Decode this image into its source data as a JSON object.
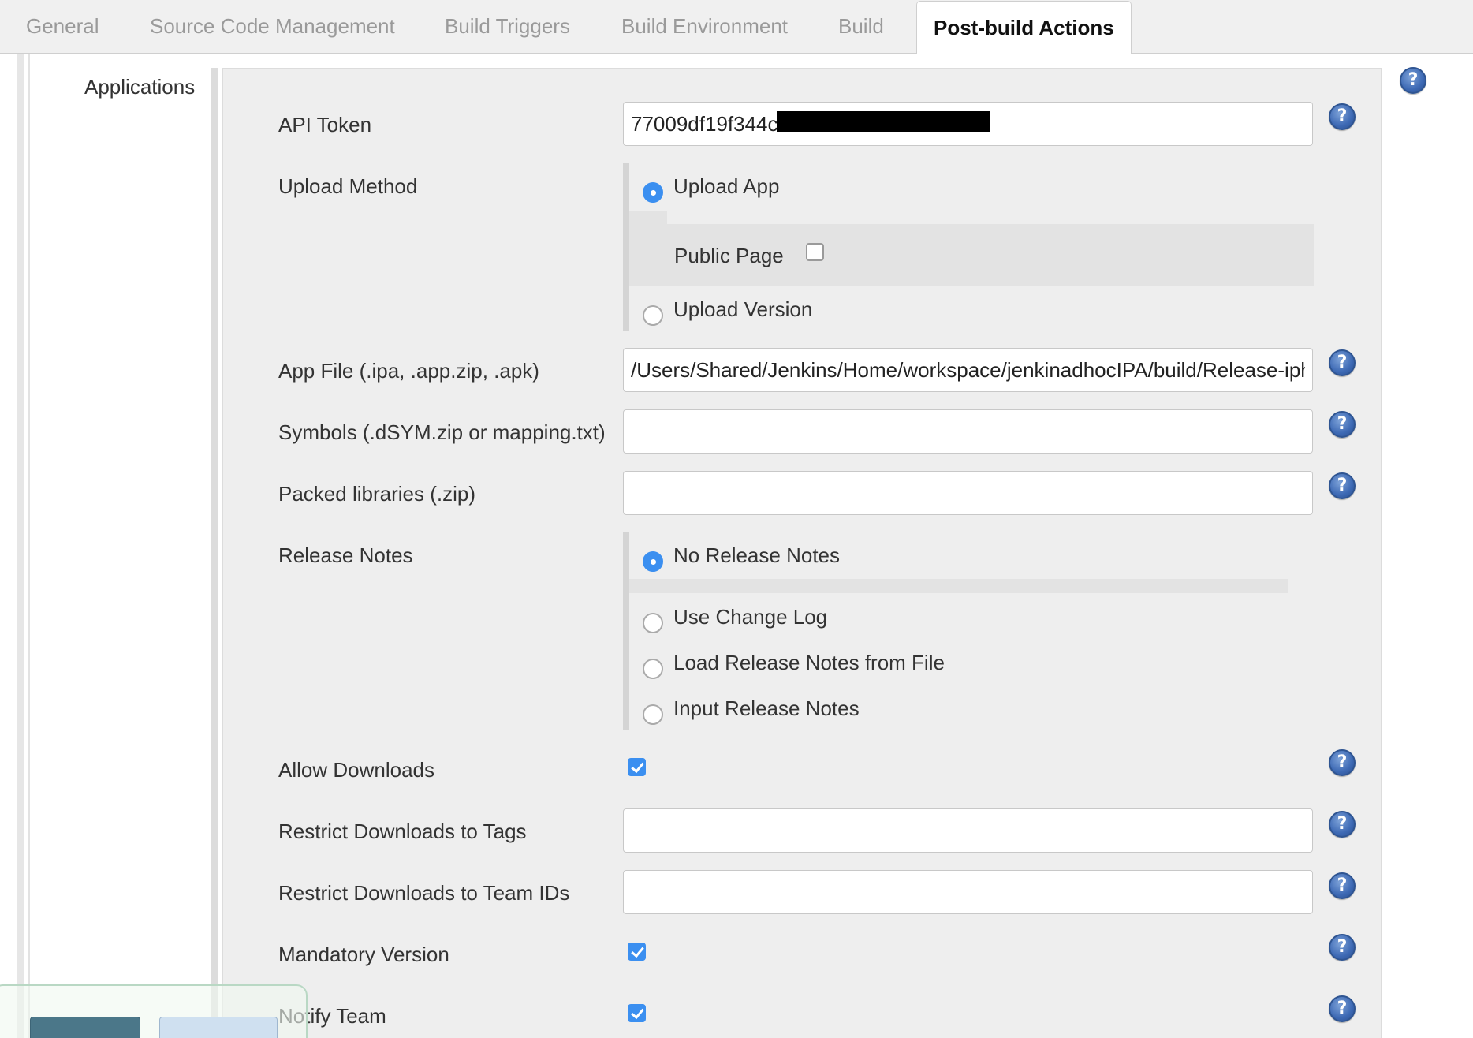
{
  "tabs": [
    {
      "label": "General"
    },
    {
      "label": "Source Code Management"
    },
    {
      "label": "Build Triggers"
    },
    {
      "label": "Build Environment"
    },
    {
      "label": "Build"
    },
    {
      "label": "Post-build Actions",
      "active": true
    }
  ],
  "section": {
    "label": "Applications"
  },
  "form": {
    "api_token": {
      "label": "API Token",
      "value": "77009df19f344c"
    },
    "upload_method": {
      "label": "Upload Method",
      "options": [
        {
          "label": "Upload App",
          "selected": true
        },
        {
          "label": "Upload Version",
          "selected": false
        }
      ],
      "public_page": {
        "label": "Public Page",
        "checked": false
      }
    },
    "app_file": {
      "label": "App File (.ipa, .app.zip, .apk)",
      "value": "/Users/Shared/Jenkins/Home/workspace/jenkinadhocIPA/build/Release-iphoneos/app.ipa"
    },
    "symbols": {
      "label": "Symbols (.dSYM.zip or mapping.txt)",
      "value": ""
    },
    "packed_libraries": {
      "label": "Packed libraries (.zip)",
      "value": ""
    },
    "release_notes": {
      "label": "Release Notes",
      "options": [
        {
          "label": "No Release Notes",
          "selected": true
        },
        {
          "label": "Use Change Log",
          "selected": false
        },
        {
          "label": "Load Release Notes from File",
          "selected": false
        },
        {
          "label": "Input Release Notes",
          "selected": false
        }
      ]
    },
    "allow_downloads": {
      "label": "Allow Downloads",
      "checked": true
    },
    "restrict_tags": {
      "label": "Restrict Downloads to Tags",
      "value": ""
    },
    "restrict_team_ids": {
      "label": "Restrict Downloads to Team IDs",
      "value": ""
    },
    "mandatory_version": {
      "label": "Mandatory Version",
      "checked": true
    },
    "notify_team": {
      "label": "Notify Team",
      "checked": true
    }
  },
  "colors": {
    "accent": "#3b8ff0",
    "help_icon": "#3d69b4",
    "panel_bg": "#eeeeee"
  }
}
